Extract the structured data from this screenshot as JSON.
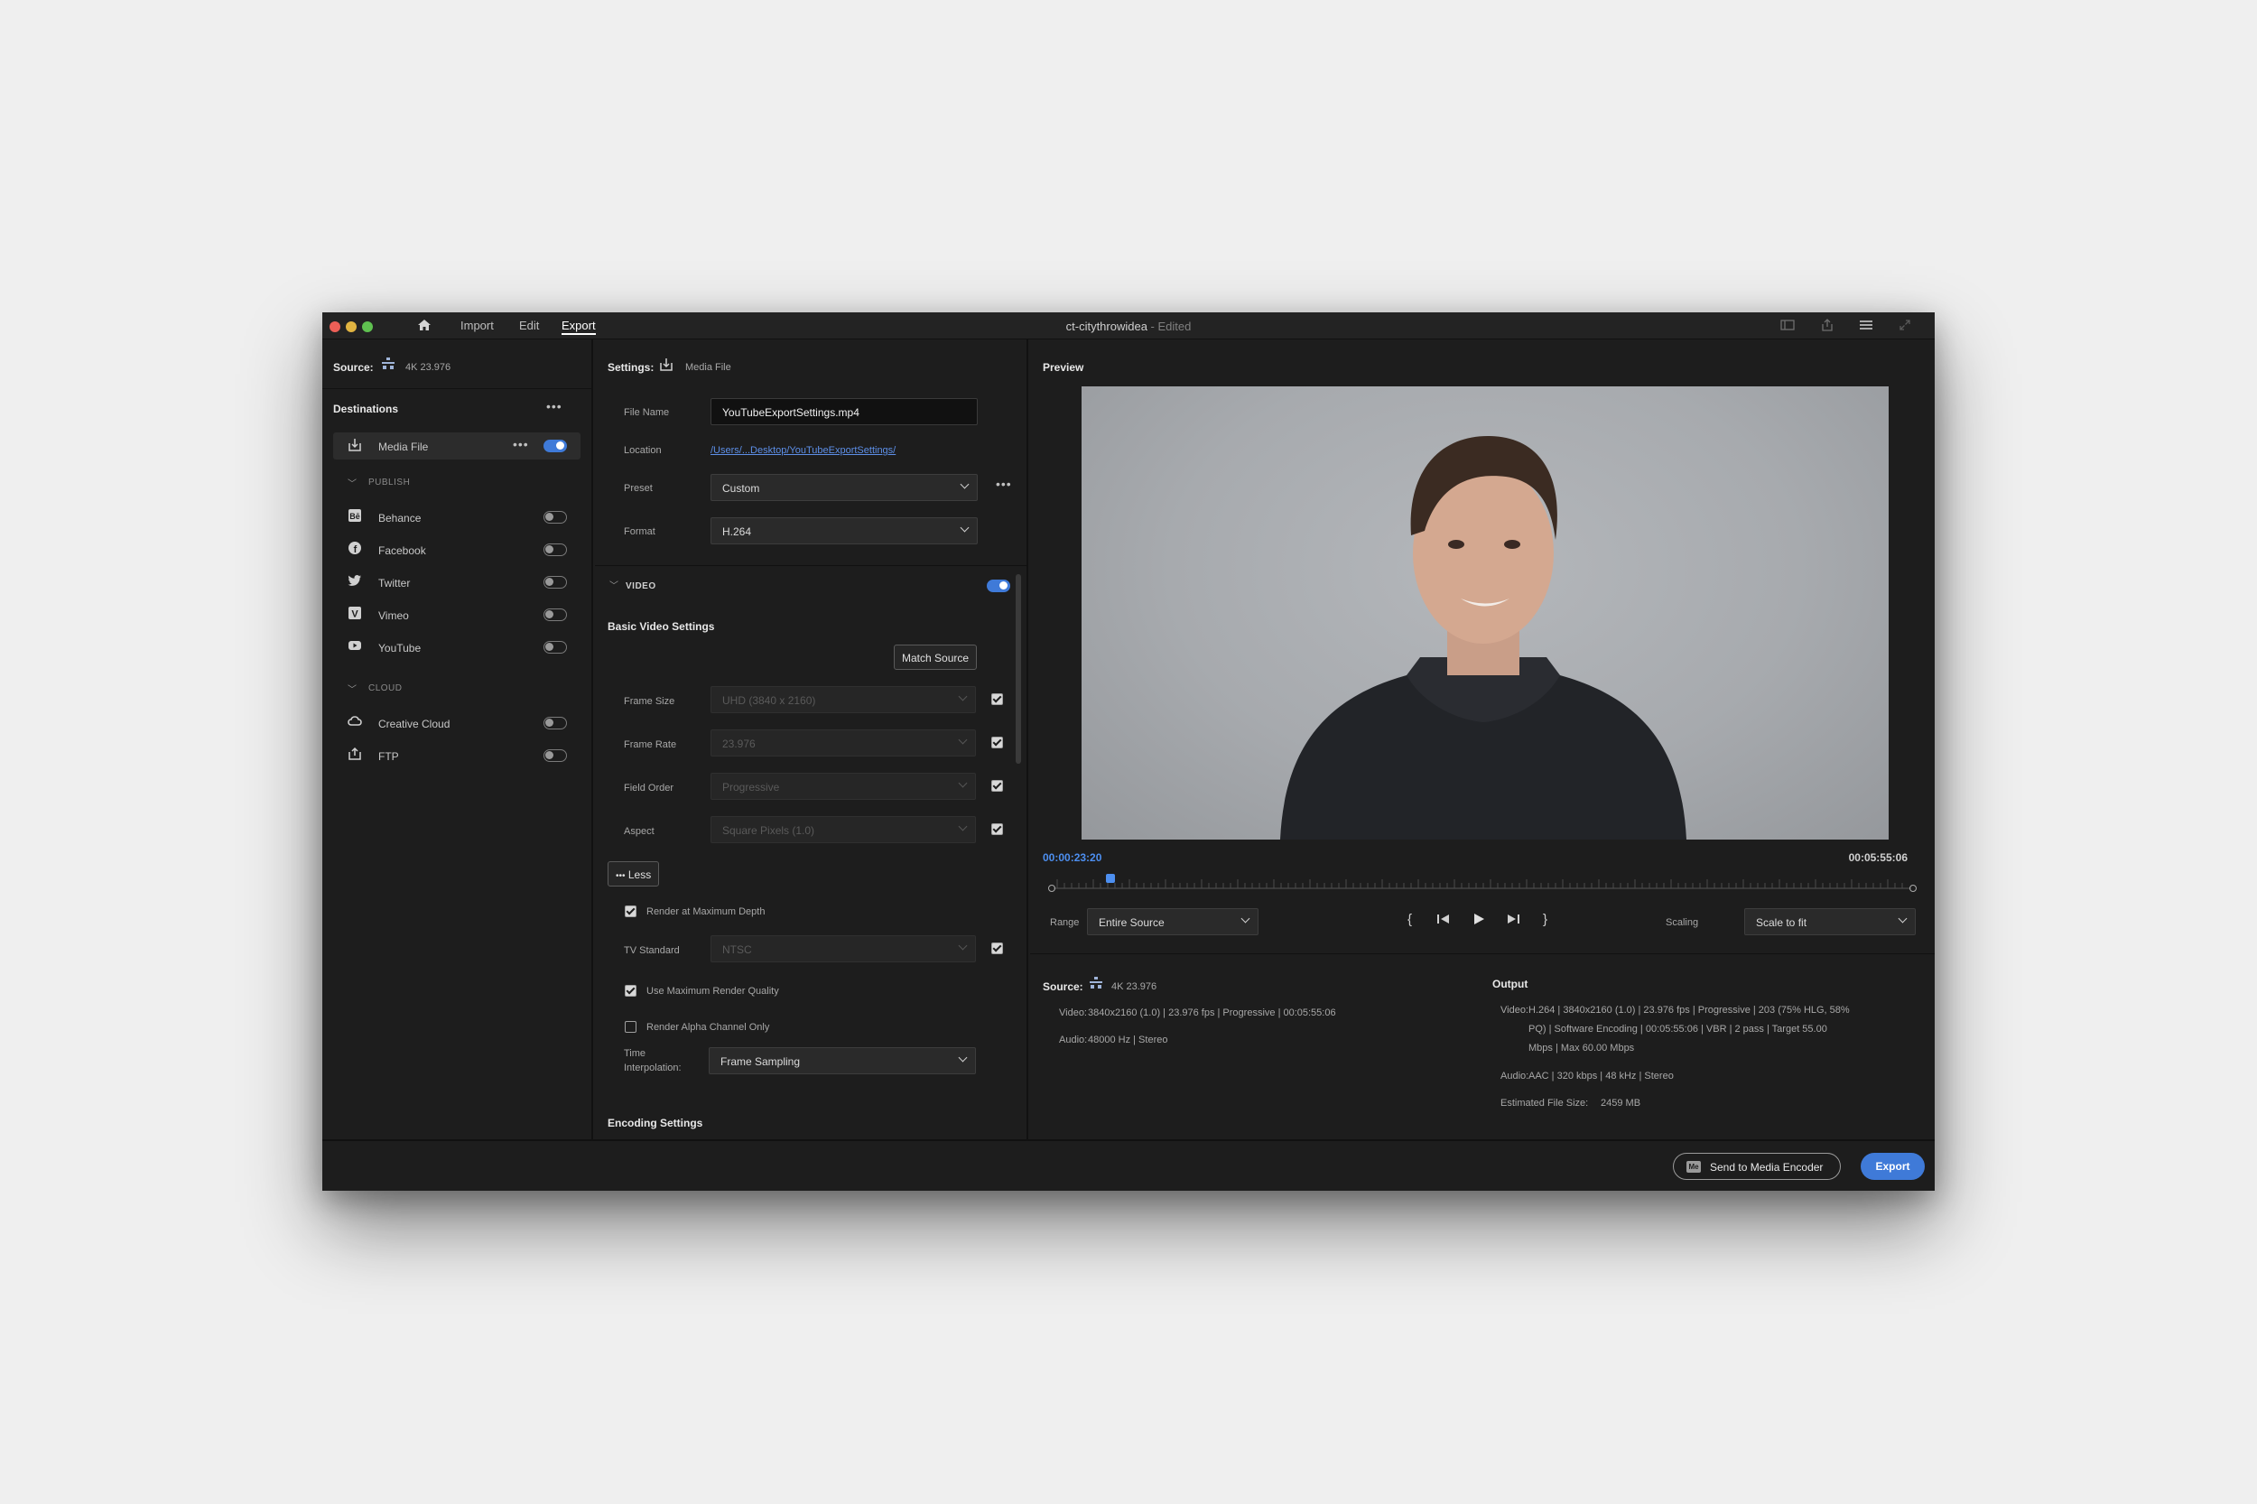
{
  "titlebar": {
    "nav": [
      "Import",
      "Edit",
      "Export"
    ],
    "active_nav": "Export",
    "doc_title": "ct-citythrowidea",
    "doc_status": " - Edited"
  },
  "source": {
    "label": "Source:",
    "value": "4K 23.976"
  },
  "destinations": {
    "header": "Destinations",
    "media_file": "Media File",
    "publish_header": "PUBLISH",
    "publish": [
      "Behance",
      "Facebook",
      "Twitter",
      "Vimeo",
      "YouTube"
    ],
    "cloud_header": "CLOUD",
    "cloud": [
      "Creative Cloud",
      "FTP"
    ]
  },
  "settings": {
    "label": "Settings:",
    "target": "Media File",
    "file_name_label": "File Name",
    "file_name": "YouTubeExportSettings.mp4",
    "location_label": "Location",
    "location": "/Users/...Desktop/YouTubeExportSettings/",
    "preset_label": "Preset",
    "preset": "Custom",
    "format_label": "Format",
    "format": "H.264",
    "video_header": "VIDEO",
    "basic_header": "Basic Video Settings",
    "match_source": "Match Source",
    "frame_size_label": "Frame Size",
    "frame_size": "UHD (3840 x 2160)",
    "frame_rate_label": "Frame Rate",
    "frame_rate": "23.976",
    "field_order_label": "Field Order",
    "field_order": "Progressive",
    "aspect_label": "Aspect",
    "aspect": "Square Pixels (1.0)",
    "less": "Less",
    "render_max_depth": "Render at Maximum Depth",
    "tv_standard_label": "TV Standard",
    "tv_standard": "NTSC",
    "max_render_quality": "Use Maximum Render Quality",
    "alpha_only": "Render Alpha Channel Only",
    "time_interp_label_1": "Time",
    "time_interp_label_2": "Interpolation:",
    "time_interp": "Frame Sampling",
    "encoding_header": "Encoding Settings"
  },
  "preview": {
    "header": "Preview",
    "current_time": "00:00:23:20",
    "duration": "00:05:55:06",
    "playhead_fraction": 0.067,
    "range_label": "Range",
    "range": "Entire Source",
    "scaling_label": "Scaling",
    "scaling": "Scale to fit"
  },
  "summary": {
    "source_label": "Source:",
    "source_value": "4K 23.976",
    "video_label": "Video:",
    "source_video": "3840x2160 (1.0)  |  23.976 fps  |  Progressive  |  00:05:55:06",
    "audio_label": "Audio:",
    "source_audio": "48000 Hz  |  Stereo",
    "output_label": "Output",
    "output_video_1": "H.264  |  3840x2160 (1.0)  |  23.976 fps  |  Progressive  |  203 (75% HLG, 58%",
    "output_video_2": "PQ)  |  Software Encoding  |  00:05:55:06  |  VBR  |  2 pass  |  Target 55.00",
    "output_video_3": "Mbps  |  Max 60.00 Mbps",
    "output_audio": "AAC  |  320 kbps  |  48 kHz  |  Stereo",
    "file_size_label": "Estimated File Size:",
    "file_size": "2459 MB"
  },
  "actions": {
    "send_to_encoder": "Send to Media Encoder",
    "export": "Export"
  },
  "colors": {
    "accent": "#3f7ad8",
    "timecode": "#4d8ff0"
  }
}
